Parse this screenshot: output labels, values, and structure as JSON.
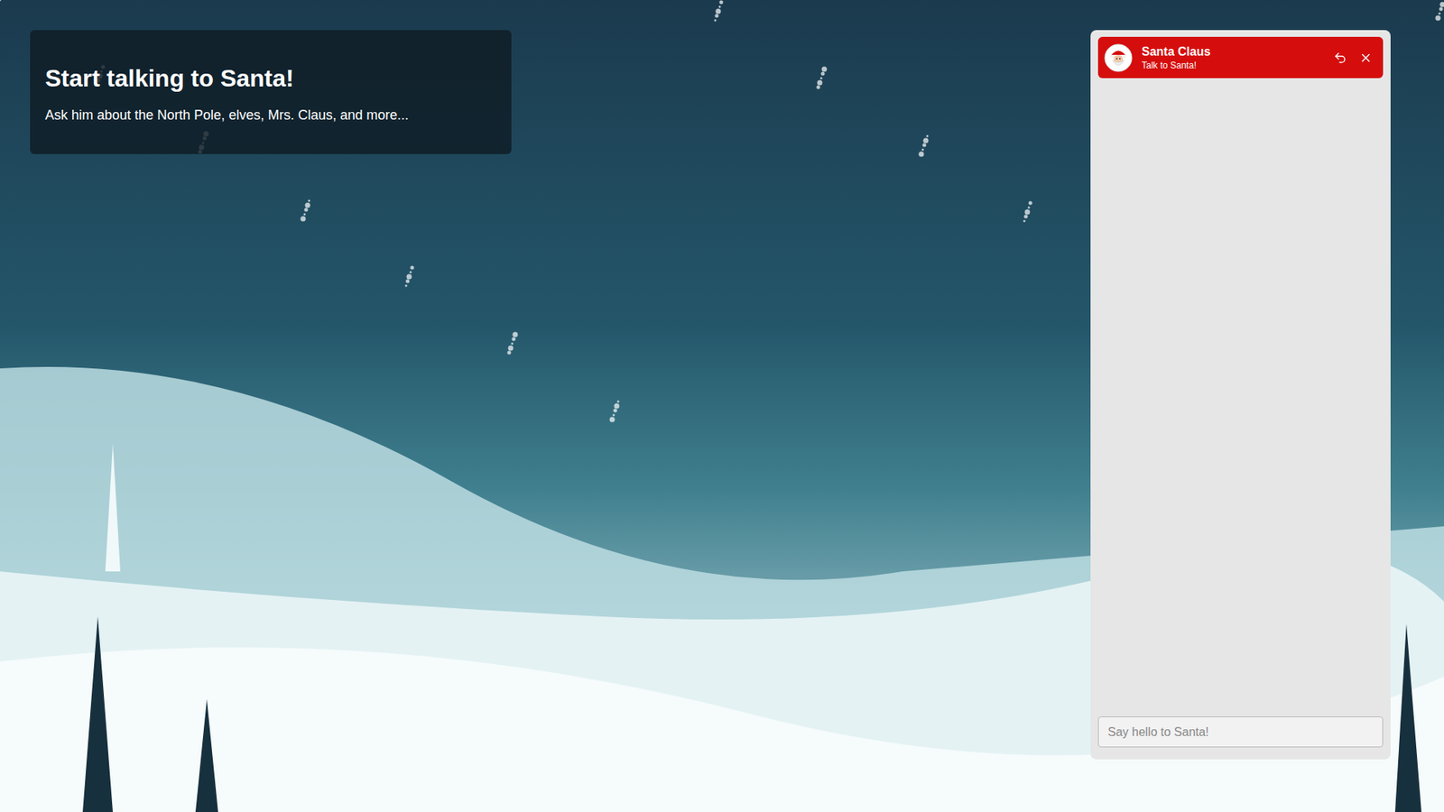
{
  "intro": {
    "title": "Start talking to Santa!",
    "subtitle": "Ask him about the North Pole, elves, Mrs. Claus, and more..."
  },
  "chat": {
    "name": "Santa Claus",
    "status": "Talk to Santa!",
    "messages": [],
    "input": {
      "placeholder": "Say hello to Santa!",
      "value": ""
    }
  }
}
